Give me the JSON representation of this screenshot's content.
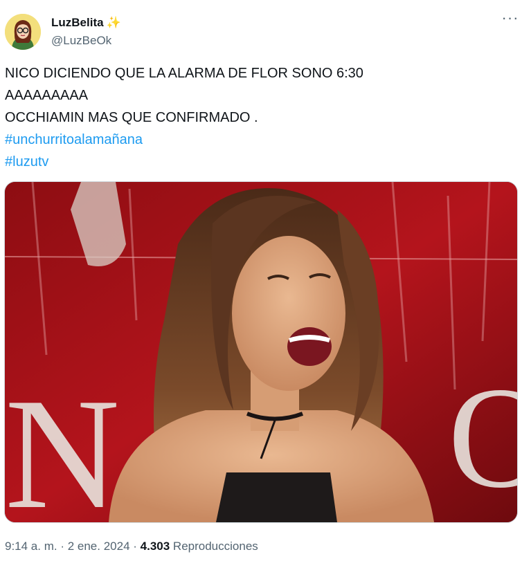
{
  "user": {
    "display_name": "LuzBelita",
    "verified_emoji": "✨",
    "handle": "@LuzBeOk",
    "avatar_icon": "cartoon-avatar-icon"
  },
  "menu": {
    "more_label": "···"
  },
  "tweet": {
    "lines": [
      "NICO DICIENDO QUE LA ALARMA DE FLOR SONO 6:30",
      "AAAAAAAAA",
      "OCCHIAMIN MAS QUE CONFIRMADO ."
    ],
    "hashtags": [
      "#unchurritoalamañana",
      "#luzutv"
    ]
  },
  "media": {
    "type": "photo",
    "accent": "#b4141c"
  },
  "meta": {
    "time": "9:14 a. m.",
    "sep1": " · ",
    "date": "2 ene. 2024",
    "sep2": " · ",
    "views_count": "4.303",
    "views_label": "Reproducciones"
  },
  "colors": {
    "link": "#1d9bf0",
    "secondary_text": "#536471",
    "primary_text": "#0f1419"
  }
}
